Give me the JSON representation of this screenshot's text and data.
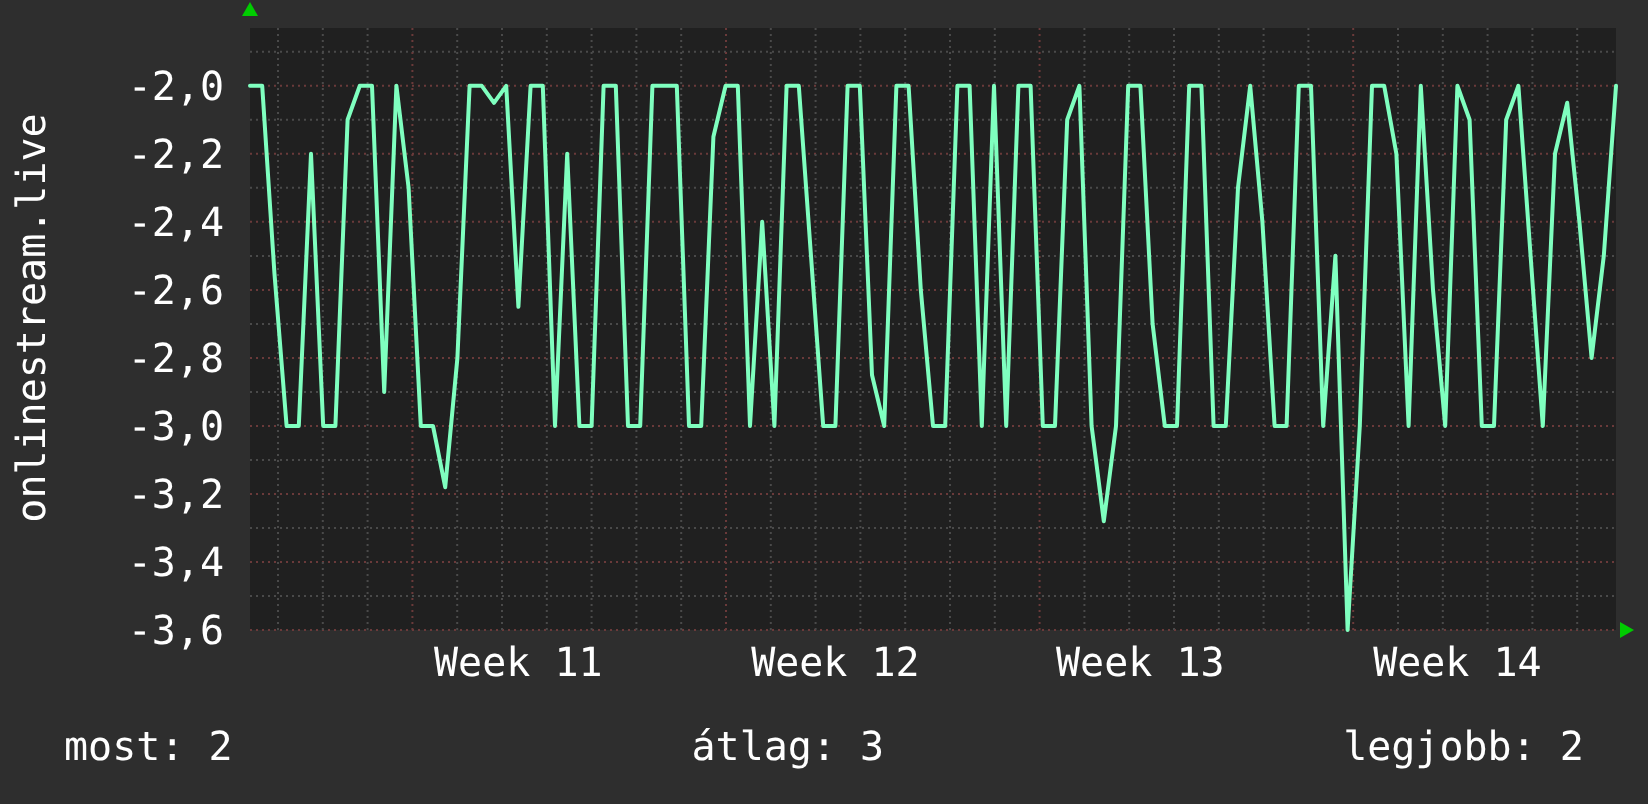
{
  "chart_data": {
    "type": "line",
    "ylabel": "onlinestream.live",
    "ylim": [
      -3.6,
      -1.83
    ],
    "grid": true,
    "categories": [
      null,
      null,
      null,
      null,
      null,
      null,
      null,
      null,
      null,
      null,
      null,
      null,
      null,
      null,
      null,
      null,
      null,
      null,
      null,
      null,
      null,
      null,
      "Week 11",
      null,
      null,
      null,
      null,
      null,
      null,
      null,
      null,
      null,
      null,
      null,
      null,
      null,
      null,
      null,
      null,
      null,
      null,
      null,
      null,
      null,
      null,
      null,
      null,
      null,
      "Week 12",
      null,
      null,
      null,
      null,
      null,
      null,
      null,
      null,
      null,
      null,
      null,
      null,
      null,
      null,
      null,
      null,
      null,
      null,
      null,
      null,
      null,
      null,
      null,
      null,
      "Week 13",
      null,
      null,
      null,
      null,
      null,
      null,
      null,
      null,
      null,
      null,
      null,
      null,
      null,
      null,
      null,
      null,
      null,
      null,
      null,
      null,
      null,
      null,
      null,
      null,
      null,
      "Week 14",
      null,
      null,
      null,
      null,
      null,
      null,
      null,
      null,
      null,
      null,
      null,
      null,
      null
    ],
    "yticks": [
      {
        "value": -2.0,
        "label": "-2,0"
      },
      {
        "value": -2.2,
        "label": "-2,2"
      },
      {
        "value": -2.4,
        "label": "-2,4"
      },
      {
        "value": -2.6,
        "label": "-2,6"
      },
      {
        "value": -2.8,
        "label": "-2,8"
      },
      {
        "value": -3.0,
        "label": "-3,0"
      },
      {
        "value": -3.2,
        "label": "-3,2"
      },
      {
        "value": -3.4,
        "label": "-3,4"
      },
      {
        "value": -3.6,
        "label": "-3,6"
      }
    ],
    "series": [
      {
        "color": "#7fffbf",
        "values": [
          -2,
          -2,
          -2.55,
          -3,
          -3,
          -2.2,
          -3,
          -3,
          -2.1,
          -2,
          -2,
          -2.9,
          -2,
          -2.3,
          -3,
          -3,
          -3.18,
          -2.8,
          -2,
          -2,
          -2.05,
          -2,
          -2.65,
          -2,
          -2,
          -3,
          -2.2,
          -3,
          -3,
          -2,
          -2,
          -3,
          -3,
          -2,
          -2,
          -2,
          -3,
          -3,
          -2.15,
          -2,
          -2,
          -3,
          -2.4,
          -3,
          -2,
          -2,
          -2.5,
          -3,
          -3,
          -2,
          -2,
          -2.85,
          -3,
          -2,
          -2,
          -2.6,
          -3,
          -3,
          -2,
          -2,
          -3,
          -2,
          -3,
          -2,
          -2,
          -3,
          -3,
          -2.1,
          -2,
          -3,
          -3.28,
          -3,
          -2,
          -2,
          -2.7,
          -3,
          -3,
          -2,
          -2,
          -3,
          -3,
          -2.3,
          -2,
          -2.4,
          -3,
          -3,
          -2,
          -2,
          -3,
          -2.5,
          -3.6,
          -3,
          -2,
          -2,
          -2.2,
          -3,
          -2,
          -2.6,
          -3,
          -2,
          -2.1,
          -3,
          -3,
          -2.1,
          -2,
          -2.5,
          -3,
          -2.2,
          -2.05,
          -2.4,
          -2.8,
          -2.5,
          -2
        ]
      }
    ]
  },
  "stats": [
    "most: 2",
    "átlag: 3",
    "legjobb: 2"
  ]
}
